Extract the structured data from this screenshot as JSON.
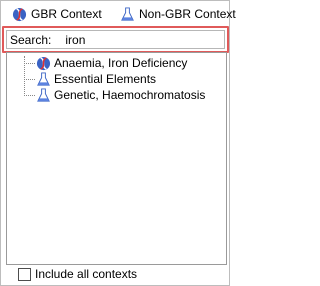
{
  "context_bar": {
    "gbr_label": "GBR Context",
    "gbr_icon": "dna-context-icon",
    "non_gbr_label": "Non-GBR Context",
    "non_gbr_icon": "flask-context-icon"
  },
  "search": {
    "label": "Search:",
    "value": "iron",
    "border_color": "#e05a5a"
  },
  "tree": {
    "items": [
      {
        "label": "Anaemia, Iron Deficiency",
        "icon": "dna-context-icon"
      },
      {
        "label": "Essential Elements",
        "icon": "flask-context-icon"
      },
      {
        "label": "Genetic, Haemochromatosis",
        "icon": "flask-context-icon"
      }
    ]
  },
  "footer": {
    "include_all_label": "Include all contexts",
    "include_all_checked": false
  }
}
